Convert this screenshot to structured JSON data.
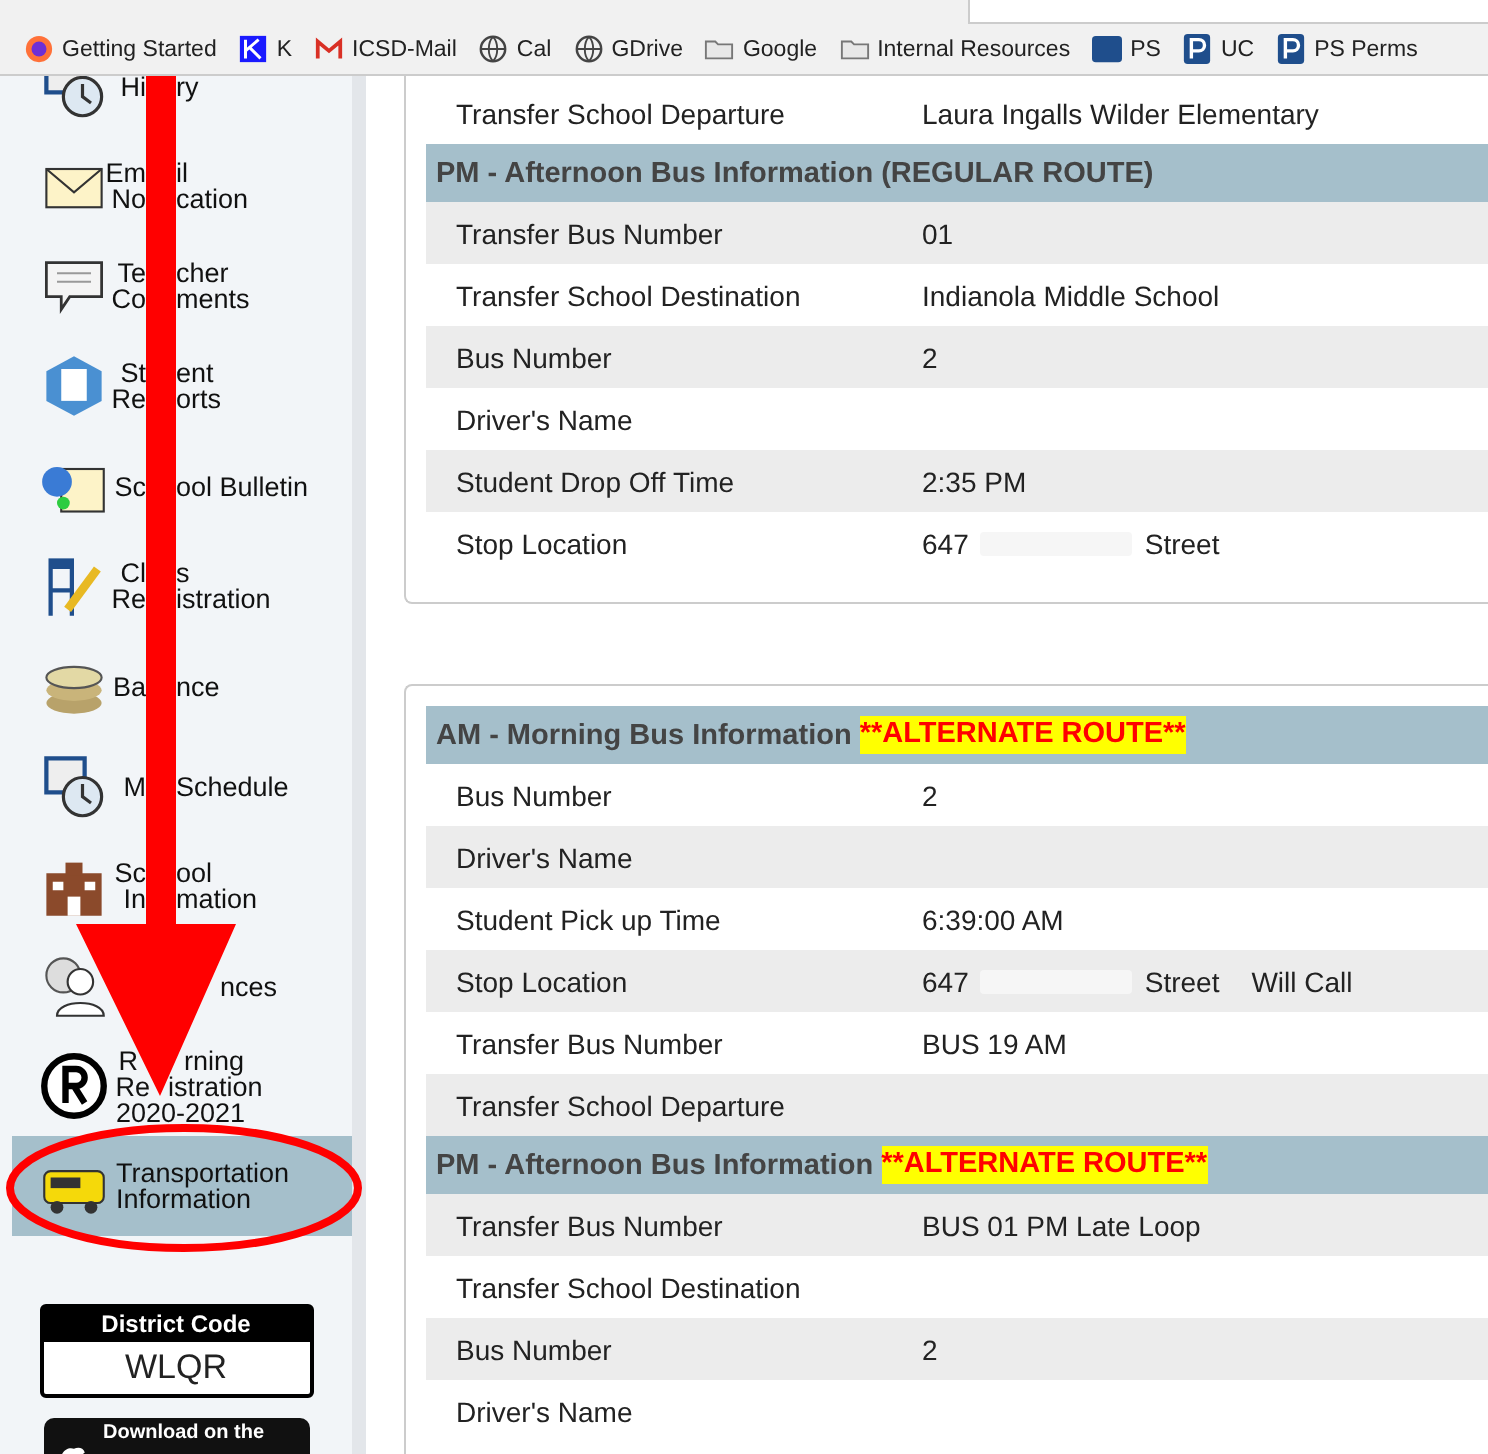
{
  "bookmarks": [
    {
      "label": "Getting Started"
    },
    {
      "label": "K"
    },
    {
      "label": "ICSD-Mail"
    },
    {
      "label": "Cal"
    },
    {
      "label": "GDrive"
    },
    {
      "label": "Google"
    },
    {
      "label": "Internal Resources"
    },
    {
      "label": "PS"
    },
    {
      "label": "UC"
    },
    {
      "label": "PS Perms"
    }
  ],
  "sidebar": {
    "items": [
      {
        "lines": [
          [
            "Hi",
            "ry"
          ]
        ],
        "selected": false
      },
      {
        "lines": [
          [
            "Em",
            "il"
          ],
          [
            "No",
            "cation"
          ]
        ],
        "selected": false
      },
      {
        "lines": [
          [
            "Te",
            "cher"
          ],
          [
            "Co",
            "ments"
          ]
        ],
        "selected": false
      },
      {
        "lines": [
          [
            "St",
            "ent"
          ],
          [
            "Re",
            "orts"
          ]
        ],
        "selected": false
      },
      {
        "lines": [
          [
            "Sc",
            "ool Bulletin"
          ]
        ],
        "selected": false
      },
      {
        "lines": [
          [
            "Cl",
            "s"
          ],
          [
            "Re",
            "istration"
          ]
        ],
        "selected": false
      },
      {
        "lines": [
          [
            "Ba",
            "nce"
          ]
        ],
        "selected": false
      },
      {
        "lines": [
          [
            "M",
            "Schedule"
          ]
        ],
        "selected": false
      },
      {
        "lines": [
          [
            "Sc",
            "ool"
          ],
          [
            "In",
            "mation"
          ]
        ],
        "selected": false
      },
      {
        "lines": [
          [
            "nces"
          ]
        ],
        "selected": false
      },
      {
        "lines": [
          [
            "R",
            "rning"
          ],
          [
            "Re",
            "istration"
          ],
          [
            "2020-2021"
          ]
        ],
        "selected": false
      },
      {
        "lines": [
          [
            "Transportation"
          ],
          [
            "Information"
          ]
        ],
        "selected": true
      }
    ],
    "district_code": {
      "title": "District Code",
      "code": "WLQR"
    },
    "app_store": {
      "label": "Download on the"
    }
  },
  "cards": [
    {
      "sections": [
        {
          "rows": [
            {
              "label": "Transfer School Departure",
              "value": "Laura Ingalls Wilder Elementary",
              "shaded": false
            }
          ]
        },
        {
          "heading": "PM - Afternoon Bus Information (REGULAR ROUTE)",
          "rows": [
            {
              "label": "Transfer Bus Number",
              "value": "01",
              "shaded": true
            },
            {
              "label": "Transfer School Destination",
              "value": "Indianola Middle School",
              "shaded": false
            },
            {
              "label": "Bus Number",
              "value": "2",
              "shaded": true
            },
            {
              "label": "Driver's Name",
              "shaded": false
            },
            {
              "label": "Student Drop Off Time",
              "value": "2:35 PM",
              "shaded": true
            },
            {
              "label": "Stop Location",
              "value": "647",
              "value_after": "Street",
              "shaded": false
            }
          ]
        }
      ]
    },
    {
      "sections": [
        {
          "heading": "AM - Morning Bus Information",
          "alert": "**ALTERNATE ROUTE**",
          "rows": [
            {
              "label": "Bus Number",
              "value": "2",
              "shaded": false
            },
            {
              "label": "Driver's Name",
              "shaded": true
            },
            {
              "label": "Student Pick up Time",
              "value": "6:39:00 AM",
              "shaded": false
            },
            {
              "label": "Stop Location",
              "value": "647",
              "value_after": "Street",
              "note": "Will Call",
              "shaded": true
            },
            {
              "label": "Transfer Bus Number",
              "value": "BUS 19 AM",
              "shaded": false
            },
            {
              "label": "Transfer School Departure",
              "shaded": true
            }
          ]
        },
        {
          "heading": "PM - Afternoon Bus Information",
          "alert": "**ALTERNATE ROUTE**",
          "rows": [
            {
              "label": "Transfer Bus Number",
              "value": "BUS 01 PM Late Loop",
              "shaded": true
            },
            {
              "label": "Transfer School Destination",
              "shaded": false
            },
            {
              "label": "Bus Number",
              "value": "2",
              "shaded": true
            },
            {
              "label": "Driver's Name",
              "shaded": false
            }
          ]
        }
      ]
    }
  ]
}
